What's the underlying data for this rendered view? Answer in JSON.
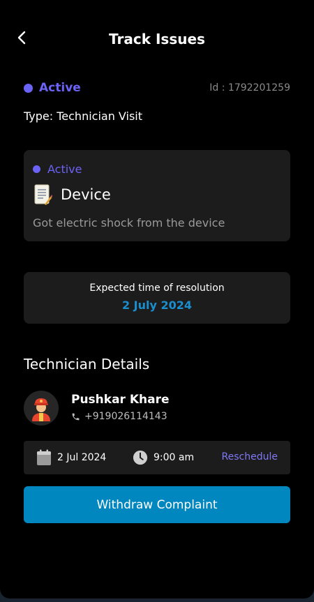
{
  "header": {
    "title": "Track Issues",
    "back_icon": "chevron-left-icon"
  },
  "ticket": {
    "status": "Active",
    "id_text": "Id : 1792201259",
    "type_text": "Type: Technician Visit",
    "status_color": "#6b63f5"
  },
  "issue": {
    "status": "Active",
    "category_icon": "document-icon",
    "category": "Device",
    "description": "Got electric shock from the device"
  },
  "resolution": {
    "label": "Expected time of resolution",
    "date": "2 July 2024",
    "date_color": "#1a8fd0"
  },
  "technician": {
    "section_title": "Technician Details",
    "avatar_icon": "technician-avatar-icon",
    "name": "Pushkar Khare",
    "phone": "+919026114143"
  },
  "schedule": {
    "date": "2 Jul 2024",
    "time": "9:00 am",
    "reschedule_label": "Reschedule"
  },
  "actions": {
    "withdraw_label": "Withdraw Complaint",
    "button_color": "#0087bf"
  }
}
